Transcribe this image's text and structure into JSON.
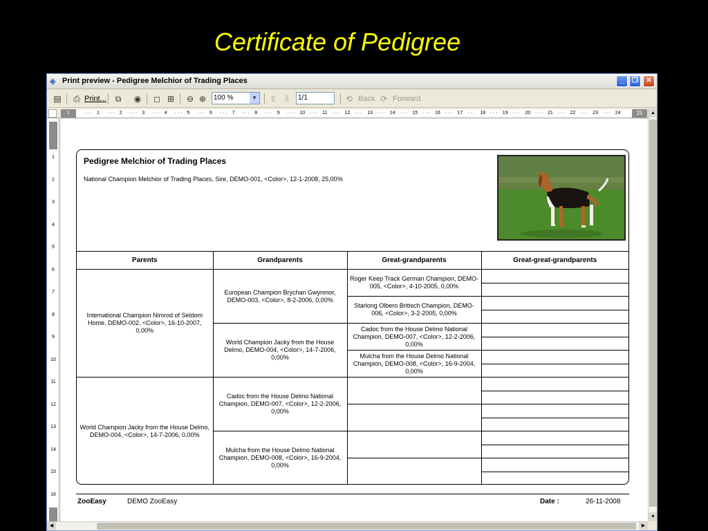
{
  "slide": {
    "title": "Certificate of Pedigree"
  },
  "window": {
    "title": "Print preview - Pedigree Melchior of Trading Places",
    "controls": {
      "minimize": "_",
      "maximize": "❐",
      "close": "✕"
    }
  },
  "toolbar": {
    "print_label": "Print...",
    "zoom_value": "100 %",
    "page_value": "1/1",
    "back_label": "Back",
    "forward_label": "Forward"
  },
  "ruler": {
    "h_ticks": [
      "1",
      "2",
      "3",
      "4",
      "5",
      "6",
      "7",
      "8",
      "9",
      "10",
      "11",
      "12",
      "13",
      "14",
      "15",
      "16",
      "17",
      "18",
      "19",
      "20",
      "21",
      "22",
      "23",
      "24"
    ],
    "h_start": "1",
    "h_end": "25",
    "v_ticks": [
      "1",
      "2",
      "3",
      "4",
      "5",
      "6",
      "7",
      "8",
      "9",
      "10",
      "11",
      "12",
      "13",
      "14",
      "15",
      "16"
    ]
  },
  "certificate": {
    "title": "Pedigree Melchior of Trading Places",
    "description": "National Champion Melchior of Trading Places, Sire, DEMO-001, <Color>, 12-1-2008, 25,00%",
    "headers": [
      "Parents",
      "Grandparents",
      "Great-grandparents",
      "Great-great-grandparents"
    ],
    "parents": [
      "International Champion Nimrod of Seldom Home, DEMO-002, <Color>, 16-10-2007, 0,00%",
      "World Champion Jacky from the House Delmo, DEMO-004, <Color>, 14-7-2006, 0,00%"
    ],
    "grandparents": [
      "European Champion Brychan Gwynmor, DEMO-003, <Color>, 8-2-2006, 0,00%",
      "World Champion Jacky from the House Delmo, DEMO-004, <Color>, 14-7-2006, 0,00%",
      "Cadoc from the House Delmo National Champion, DEMO-007, <Color>, 12-2-2006, 0,00%",
      "Mulcha from the House Delmo National Champion, DEMO-008, <Color>, 16-9-2004, 0,00%"
    ],
    "great_grandparents": [
      "Roger Keep Track German Champion, DEMO-005, <Color>, 4-10-2005, 0,00%",
      "Starlong Olbero Britisch Champion, DEMO-006, <Color>, 3-2-2005, 0,00%",
      "Cadoc from the House Delmo National Champion, DEMO-007, <Color>, 12-2-2006, 0,00%",
      "Mulcha from the House Delmo National Champion, DEMO-008, <Color>, 16-9-2004, 0,00%",
      "",
      "",
      "",
      ""
    ]
  },
  "footer": {
    "company": "ZooEasy",
    "product": "DEMO ZooEasy",
    "date_label": "Date :",
    "date_value": "26-11-2008"
  },
  "colors": {
    "slide_title": "#ffff00",
    "background": "#000000",
    "window_chrome": "#ece9d8"
  }
}
